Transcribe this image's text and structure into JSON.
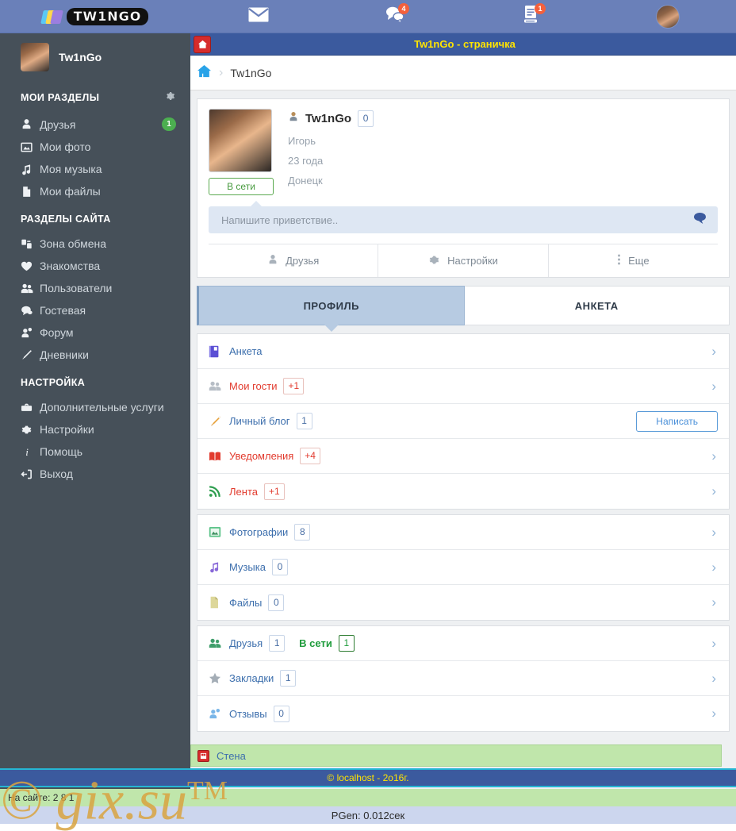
{
  "topbar": {
    "logo_text": "TW1NGO",
    "nav": [
      {
        "name": "mail",
        "icon": "envelope-icon",
        "badge": ""
      },
      {
        "name": "messages",
        "icon": "chat-icon",
        "badge": "4"
      },
      {
        "name": "notes",
        "icon": "note-icon",
        "badge": "1"
      },
      {
        "name": "account",
        "icon": "avatar-icon",
        "badge": ""
      }
    ]
  },
  "sidebar": {
    "username": "Tw1nGo",
    "groups": [
      {
        "title": "МОИ РАЗДЕЛЫ",
        "gear": "gear-icon",
        "items": [
          {
            "icon": "user-icon",
            "label": "Друзья",
            "badge": "1"
          },
          {
            "icon": "photo-icon",
            "label": "Мои фото",
            "badge": ""
          },
          {
            "icon": "music-icon",
            "label": "Моя музыка",
            "badge": ""
          },
          {
            "icon": "file-icon",
            "label": "Мои файлы",
            "badge": ""
          }
        ]
      },
      {
        "title": "РАЗДЕЛЫ САЙТА",
        "gear": "",
        "items": [
          {
            "icon": "exchange-icon",
            "label": "Зона обмена",
            "badge": ""
          },
          {
            "icon": "heart-icon",
            "label": "Знакомства",
            "badge": ""
          },
          {
            "icon": "users-icon",
            "label": "Пользователи",
            "badge": ""
          },
          {
            "icon": "comment-icon",
            "label": "Гостевая",
            "badge": ""
          },
          {
            "icon": "forum-icon",
            "label": "Форум",
            "badge": ""
          },
          {
            "icon": "pen-icon",
            "label": "Дневники",
            "badge": ""
          }
        ]
      },
      {
        "title": "НАСТРОЙКА",
        "gear": "",
        "items": [
          {
            "icon": "briefcase-icon",
            "label": "Дополнительные услуги",
            "badge": ""
          },
          {
            "icon": "gear-icon",
            "label": "Настройки",
            "badge": ""
          },
          {
            "icon": "info-icon",
            "label": "Помощь",
            "badge": ""
          },
          {
            "icon": "logout-icon",
            "label": "Выход",
            "badge": ""
          }
        ]
      }
    ]
  },
  "page": {
    "title_bar": "Tw1nGo - страничка",
    "breadcrumb": "Tw1nGo"
  },
  "profile": {
    "name": "Tw1nGo",
    "rating": "0",
    "real_name": "Игорь",
    "age": "23 года",
    "city": "Донецк",
    "online_label": "В сети",
    "greeting_placeholder": "Напишите приветствие..",
    "greeting_value": "",
    "actions": [
      {
        "icon": "user-icon",
        "label": "Друзья"
      },
      {
        "icon": "gear-icon",
        "label": "Настройки"
      },
      {
        "icon": "dots-icon",
        "label": "Еще"
      }
    ]
  },
  "tabs": [
    {
      "label": "ПРОФИЛЬ",
      "active": true
    },
    {
      "label": "АНКЕТА",
      "active": false
    }
  ],
  "sections": [
    {
      "icon": "notebook-icon",
      "label": "Анкета",
      "label_color": "blue",
      "badge": "",
      "badge_color": "",
      "badge2_label": "",
      "badge2": "",
      "button": "",
      "chevron": true,
      "gap_after": false
    },
    {
      "icon": "guests-icon",
      "label": "Мои гости",
      "label_color": "red",
      "badge": "+1",
      "badge_color": "red",
      "badge2_label": "",
      "badge2": "",
      "button": "",
      "chevron": true,
      "gap_after": false
    },
    {
      "icon": "quill-icon",
      "label": "Личный блог",
      "label_color": "blue",
      "badge": "1",
      "badge_color": "blue",
      "badge2_label": "",
      "badge2": "",
      "button": "Написать",
      "chevron": false,
      "gap_after": false
    },
    {
      "icon": "book-icon",
      "label": "Уведомления",
      "label_color": "red",
      "badge": "+4",
      "badge_color": "red",
      "badge2_label": "",
      "badge2": "",
      "button": "",
      "chevron": true,
      "gap_after": false
    },
    {
      "icon": "rss-icon",
      "label": "Лента",
      "label_color": "red",
      "badge": "+1",
      "badge_color": "red",
      "badge2_label": "",
      "badge2": "",
      "button": "",
      "chevron": true,
      "gap_after": true
    },
    {
      "icon": "photo-icon",
      "label": "Фотографии",
      "label_color": "blue",
      "badge": "8",
      "badge_color": "blue",
      "badge2_label": "",
      "badge2": "",
      "button": "",
      "chevron": true,
      "gap_after": false
    },
    {
      "icon": "music-icon",
      "label": "Музыка",
      "label_color": "blue",
      "badge": "0",
      "badge_color": "blue",
      "badge2_label": "",
      "badge2": "",
      "button": "",
      "chevron": true,
      "gap_after": false
    },
    {
      "icon": "file-icon",
      "label": "Файлы",
      "label_color": "blue",
      "badge": "0",
      "badge_color": "blue",
      "badge2_label": "",
      "badge2": "",
      "button": "",
      "chevron": true,
      "gap_after": true
    },
    {
      "icon": "friends-icon",
      "label": "Друзья",
      "label_color": "blue",
      "badge": "1",
      "badge_color": "blue",
      "badge2_label": "В сети",
      "badge2": "1",
      "button": "",
      "chevron": true,
      "gap_after": false
    },
    {
      "icon": "star-icon",
      "label": "Закладки",
      "label_color": "blue",
      "badge": "1",
      "badge_color": "blue",
      "badge2_label": "",
      "badge2": "",
      "button": "",
      "chevron": true,
      "gap_after": false
    },
    {
      "icon": "review-icon",
      "label": "Отзывы",
      "label_color": "blue",
      "badge": "0",
      "badge_color": "blue",
      "badge2_label": "",
      "badge2": "",
      "button": "",
      "chevron": true,
      "gap_after": false
    }
  ],
  "wall": {
    "label": "Стена",
    "icon": "wall-icon"
  },
  "footer": {
    "copyright": "© localhost - 2o16г.",
    "online_counts": "На сайте: 2 8 1",
    "pgen": "PGen: 0.012сек",
    "watermark": "© gix.su",
    "watermark_tm": "TM"
  },
  "colors": {
    "topbar": "#6a80b9",
    "sidebar": "#465059",
    "title_bar": "#3b5a9e",
    "accent_yellow": "#ffe400",
    "tab_active": "#b7cbe2",
    "green_strip": "#c0e6ab",
    "badge_red": "#f4603c",
    "badge_green": "#4caf50",
    "link_blue": "#3d6fad",
    "alert_red": "#e23b2e"
  }
}
